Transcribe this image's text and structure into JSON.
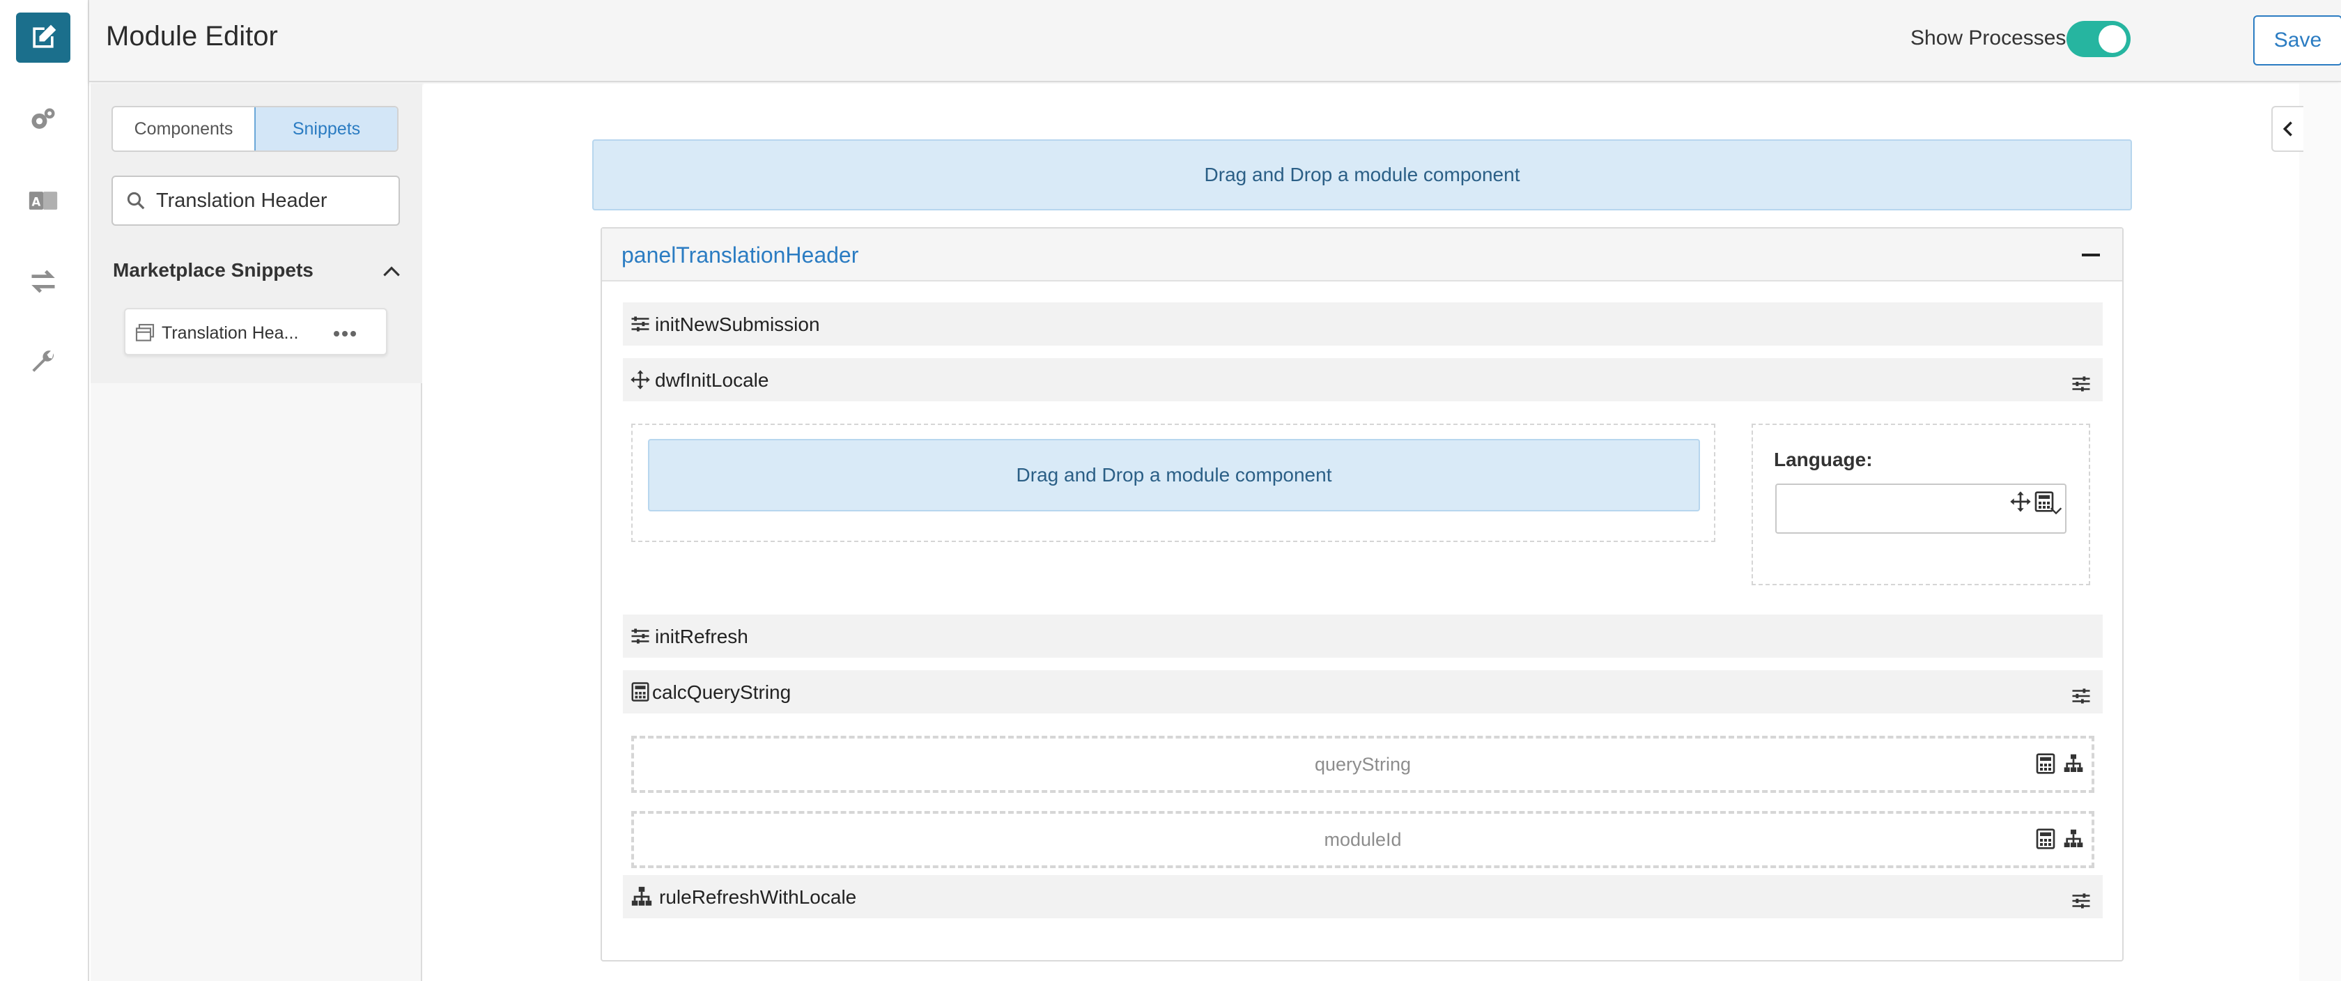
{
  "header": {
    "title": "Module Editor",
    "show_processes_label": "Show Processes",
    "show_processes_on": true,
    "save_label": "Save"
  },
  "rail": {
    "items": [
      "edit-icon",
      "settings-gears-icon",
      "translate-icon",
      "swap-arrows-icon",
      "wrench-icon"
    ],
    "active_color": "#1b6f8c"
  },
  "side_panel": {
    "tabs": [
      "Components",
      "Snippets"
    ],
    "active_tab": "Snippets",
    "search_value": "Translation Header",
    "section_title": "Marketplace Snippets",
    "snippet_label": "Translation Hea..."
  },
  "canvas": {
    "top_dropzone": "Drag and Drop a module component",
    "panel_title": "panelTranslationHeader",
    "rows": {
      "init_new_submission": "initNewSubmission",
      "dwf_init_locale": "dwfInitLocale",
      "init_refresh": "initRefresh",
      "calc_query_string": "calcQueryString",
      "rule_refresh_with_locale": "ruleRefreshWithLocale"
    },
    "inner_dropzone": "Drag and Drop a module component",
    "language_label": "Language:",
    "fields": {
      "query_string": "queryString",
      "module_id": "moduleId"
    }
  },
  "colors": {
    "accent": "#2b7cc2",
    "toggle": "#26b5a0",
    "dropzone_bg": "#d9eaf7"
  }
}
